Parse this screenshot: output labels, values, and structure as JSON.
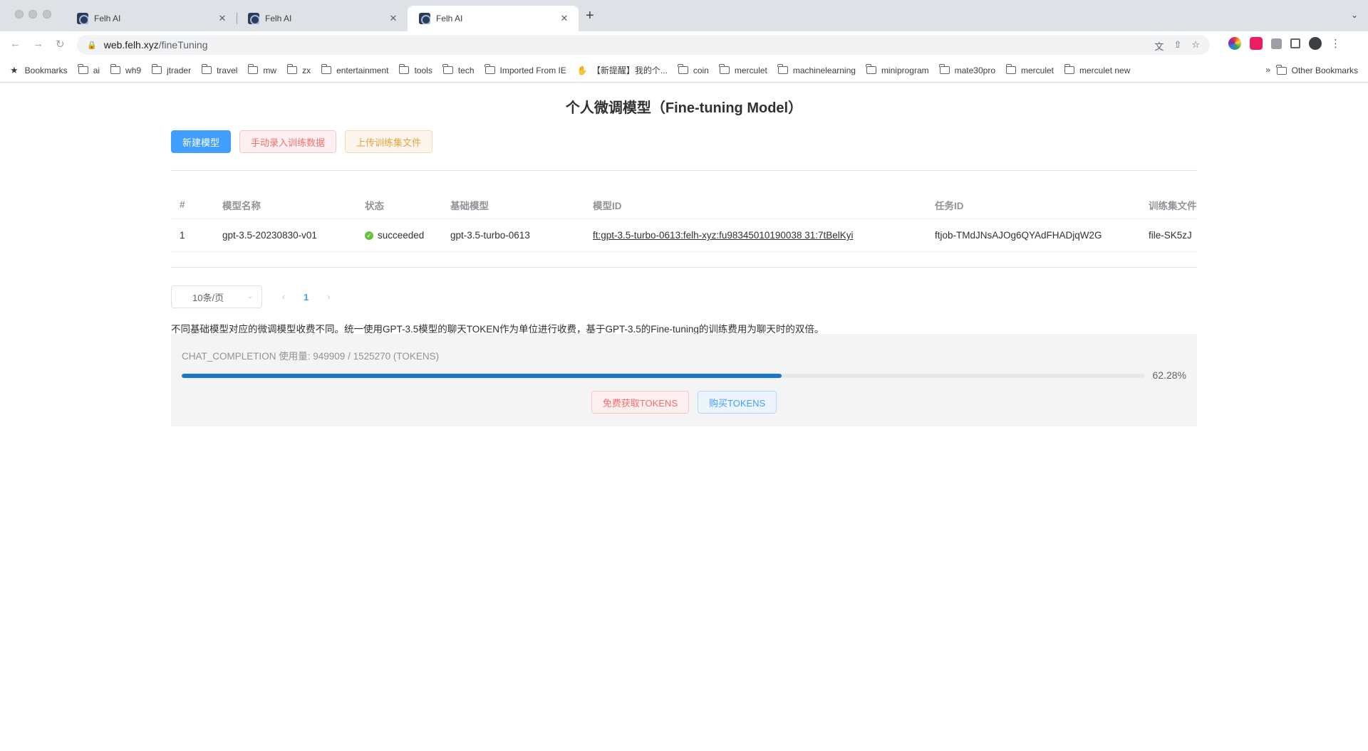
{
  "browser": {
    "tabs": [
      {
        "title": "Felh AI",
        "close": "✕"
      },
      {
        "title": "Felh AI",
        "close": "✕"
      },
      {
        "title": "Felh AI",
        "close": "✕"
      }
    ],
    "new_tab": "+",
    "tab_menu": "⌄",
    "url_host": "web.felh.xyz",
    "url_path": "/fineTuning",
    "bookmarks": [
      "ai",
      "wh9",
      "jtrader",
      "travel",
      "mw",
      "zx",
      "entertainment",
      "tools",
      "tech",
      "Imported From IE",
      "【新提醒】我的个...",
      "coin",
      "merculet",
      "machinelearning",
      "miniprogram",
      "mate30pro",
      "merculet",
      "merculet new"
    ],
    "bookmarks_label": "Bookmarks",
    "bookmarks_more": "»",
    "other_bookmarks": "Other Bookmarks"
  },
  "page": {
    "title": "个人微调模型（Fine-tuning Model）",
    "actions": {
      "new_model": "新建模型",
      "manual_input": "手动录入训练数据",
      "upload_file": "上传训练集文件"
    },
    "table": {
      "headers": [
        "#",
        "模型名称",
        "状态",
        "基础模型",
        "模型ID",
        "任务ID",
        "训练集文件"
      ],
      "rows": [
        {
          "index": "1",
          "name": "gpt-3.5-20230830-v01",
          "status": "succeeded",
          "base_model": "gpt-3.5-turbo-0613",
          "model_id": "ft:gpt-3.5-turbo-0613:felh-xyz:fu98345010190038 31:7tBelKyi",
          "job_id": "ftjob-TMdJNsAJOg6QYAdFHADjqW2G",
          "file": "file-SK5zJ"
        }
      ]
    },
    "pagination": {
      "page_size": "10条/页",
      "current_page": "1",
      "prev": "‹",
      "next": "›"
    },
    "note": "不同基础模型对应的微调模型收费不同。统一使用GPT-3.5模型的聊天TOKEN作为单位进行收费，基于GPT-3.5的Fine-tuning的训练费用为聊天时的双倍。",
    "usage": {
      "label": "CHAT_COMPLETION 使用量:   949909 / 1525270 (TOKENS)",
      "percent_text": "62.28%",
      "percent_value": 62.28,
      "free_button": "免费获取TOKENS",
      "buy_button": "购买TOKENS"
    }
  }
}
